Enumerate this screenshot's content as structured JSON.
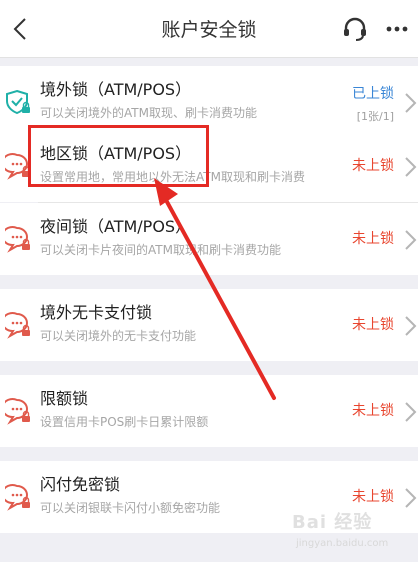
{
  "header": {
    "title": "账户安全锁",
    "back_icon": "chevron-left-icon",
    "support_icon": "headset-icon",
    "more_icon": "more-dots-icon"
  },
  "colors": {
    "enabled": "#3a86d6",
    "disabled": "#e8462f",
    "icon_enabled": "#1fb0a8",
    "icon_disabled": "#e05a4c",
    "annotation": "#e42a24"
  },
  "rows": [
    {
      "label": "境外锁（ATM/POS）",
      "desc": "可以关闭境外的ATM取现、刷卡消费功能",
      "status": "已上锁",
      "count": "[1张/1]",
      "icon": "shield-lock-icon"
    },
    {
      "label": "地区锁（ATM/POS）",
      "desc": "设置常用地，常用地以外无法ATM取现和刷卡消费",
      "status": "未上锁",
      "icon": "chat-lock-icon"
    },
    {
      "label": "夜间锁（ATM/POS）",
      "desc": "可以关闭卡片夜间的ATM取现和刷卡消费功能",
      "status": "未上锁",
      "icon": "chat-lock-icon"
    },
    {
      "label": "境外无卡支付锁",
      "desc": "可以关闭境外的无卡支付功能",
      "status": "未上锁",
      "icon": "chat-lock-icon"
    },
    {
      "label": "限额锁",
      "desc": "设置信用卡POS刷卡日累计限额",
      "status": "未上锁",
      "icon": "chat-lock-icon"
    },
    {
      "label": "闪付免密锁",
      "desc": "可以关闭银联卡闪付小额免密功能",
      "status": "未上锁",
      "icon": "chat-lock-icon"
    }
  ],
  "watermark": {
    "text": "Bai 经验",
    "sub": "jingyan.baidu.com"
  }
}
